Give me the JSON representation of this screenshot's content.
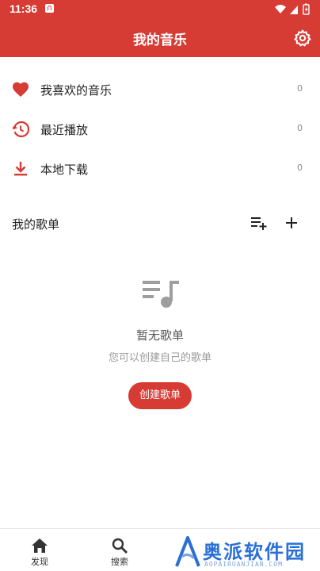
{
  "status_bar": {
    "time": "11:36"
  },
  "app_bar": {
    "title": "我的音乐"
  },
  "menu": [
    {
      "label": "我喜欢的音乐",
      "count": "0",
      "icon": "heart-icon"
    },
    {
      "label": "最近播放",
      "count": "0",
      "icon": "history-icon"
    },
    {
      "label": "本地下载",
      "count": "0",
      "icon": "download-icon"
    }
  ],
  "playlists": {
    "title": "我的歌单",
    "empty_title": "暂无歌单",
    "empty_subtitle": "您可以创建自己的歌单",
    "create_label": "创建歌单"
  },
  "bottom_nav": [
    {
      "label": "发现",
      "icon": "home-icon"
    },
    {
      "label": "搜索",
      "icon": "search-icon"
    }
  ],
  "watermark": {
    "text": "奥派软件园",
    "sub": "AOPAIRUANJIAN.COM"
  },
  "colors": {
    "brand": "#d63b34",
    "background": "#ffffff",
    "watermark": "#2a6fd6"
  }
}
